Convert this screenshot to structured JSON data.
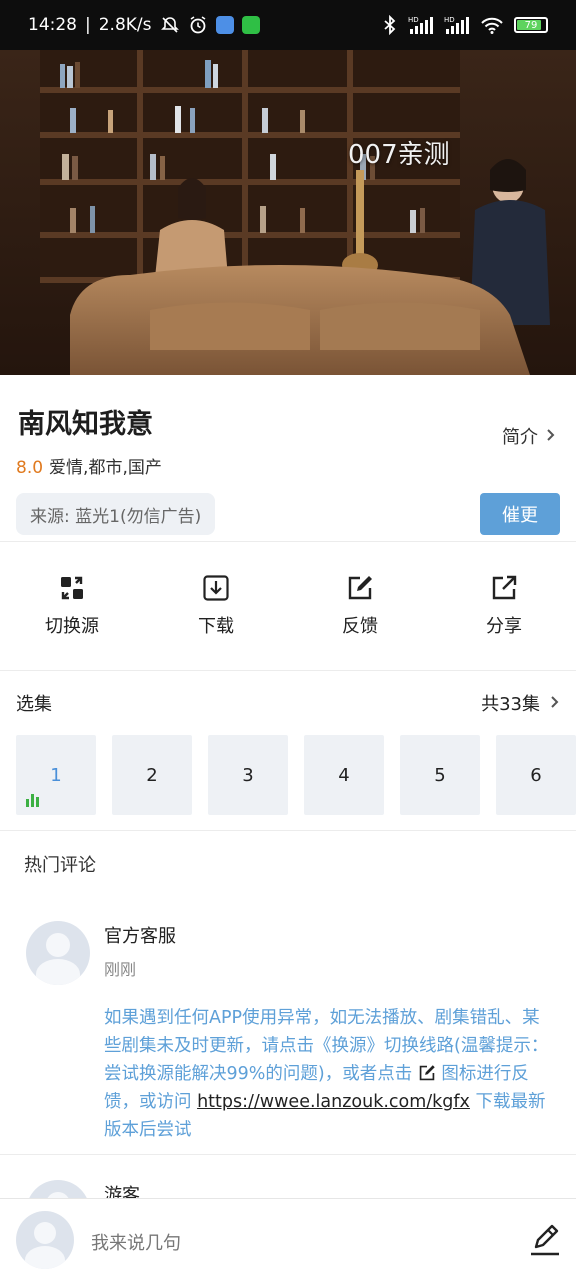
{
  "status_bar": {
    "time": "14:28",
    "network_speed": "2.8K/s",
    "battery_level": "79",
    "icons": [
      "mute-icon",
      "alarm-icon",
      "app-icon",
      "wechat-icon",
      "bluetooth-icon",
      "signal-hd-icon",
      "signal-hd-icon",
      "wifi-icon",
      "battery-icon"
    ]
  },
  "video": {
    "watermark": "007亲测"
  },
  "show": {
    "title": "南风知我意",
    "intro_label": "简介",
    "rating": "8.0",
    "genres": "爱情,都市,国产",
    "source": "来源: 蓝光1(勿信广告)",
    "urge_label": "催更"
  },
  "actions": [
    {
      "label": "切换源",
      "icon": "switch-source-icon"
    },
    {
      "label": "下载",
      "icon": "download-icon"
    },
    {
      "label": "反馈",
      "icon": "feedback-icon"
    },
    {
      "label": "分享",
      "icon": "share-icon"
    }
  ],
  "episodes": {
    "heading": "选集",
    "count_label": "共33集",
    "items": [
      "1",
      "2",
      "3",
      "4",
      "5",
      "6"
    ],
    "active": "1"
  },
  "comments": {
    "heading": "热门评论",
    "items": [
      {
        "name": "官方客服",
        "time": "刚刚",
        "text_before": "如果遇到任何APP使用异常，如无法播放、剧集错乱、某些剧集未及时更新，请点击《换源》切换线路(温馨提示：尝试换源能解决99%的问题)，或者点击",
        "text_middle": "图标进行反馈，或访问",
        "link": "https://wwee.lanzouk.com/kgfx",
        "text_after": "下载最新版本后尝试"
      },
      {
        "name": "游客"
      }
    ]
  },
  "bottom_bar": {
    "placeholder": "我来说几句"
  },
  "colors": {
    "accent": "#5ea0d8",
    "rating": "#e07a1f",
    "chip_bg": "#eef1f5",
    "status_bar_bg": "#0d0d0d"
  }
}
